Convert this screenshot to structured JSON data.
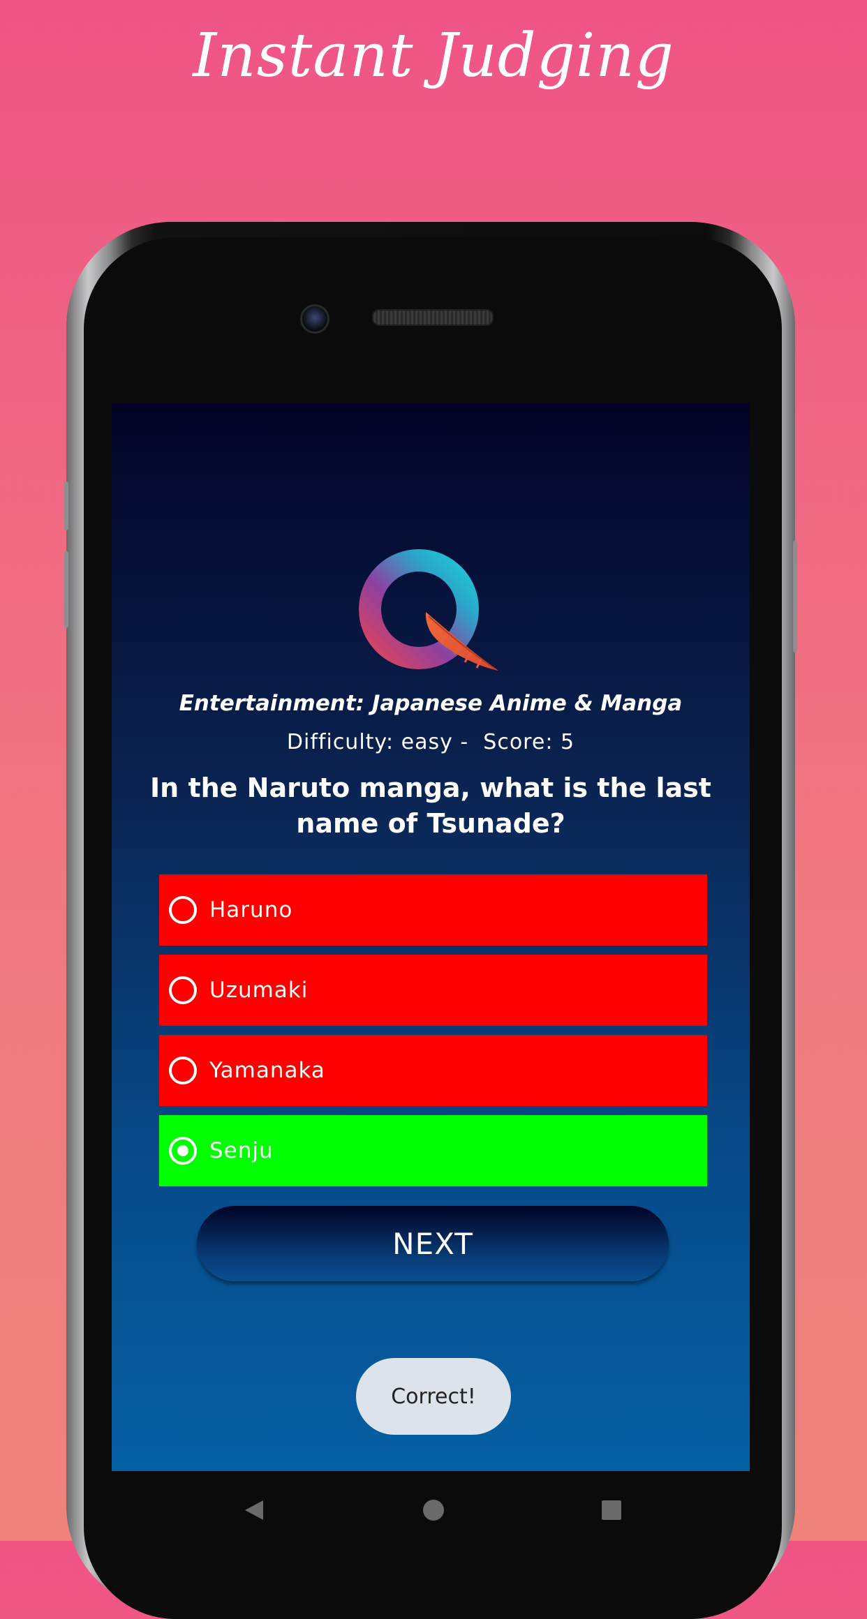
{
  "promo": {
    "title": "Instant Judging"
  },
  "quiz": {
    "category": "Entertainment: Japanese Anime & Manga",
    "meta": "Difficulty: easy -  Score: 5",
    "question": "In the Naruto manga, what is the last name of Tsunade?",
    "options": [
      {
        "label": "Haruno",
        "state": "wrong",
        "selected": false
      },
      {
        "label": "Uzumaki",
        "state": "wrong",
        "selected": false
      },
      {
        "label": "Yamanaka",
        "state": "wrong",
        "selected": false
      },
      {
        "label": "Senju",
        "state": "correct",
        "selected": true
      }
    ],
    "next_label": "NEXT",
    "toast": "Correct!"
  },
  "colors": {
    "wrong": "#ff0000",
    "correct": "#00ff00"
  },
  "nav": {
    "back_icon": "back-triangle",
    "home_icon": "home-circle",
    "recents_icon": "recents-square"
  }
}
